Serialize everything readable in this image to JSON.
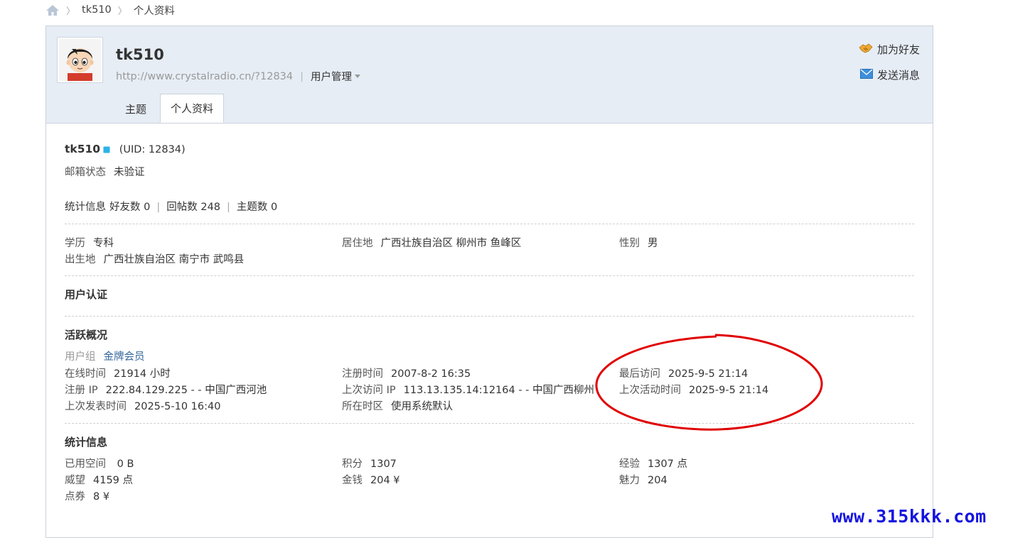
{
  "breadcrumb": {
    "user": "tk510",
    "current": "个人资料"
  },
  "header": {
    "username": "tk510",
    "url": "http://www.crystalradio.cn/?12834",
    "manage_label": "用户管理",
    "actions": {
      "add_friend": "加为好友",
      "send_message": "发送消息"
    },
    "tabs": [
      "主题",
      "个人资料"
    ]
  },
  "profile": {
    "name": "tk510",
    "uid": "(UID: 12834)",
    "email_label": "邮箱状态",
    "email_value": "未验证",
    "stats_label": "统计信息",
    "friends": "好友数 0",
    "replies": "回帖数 248",
    "topics": "主题数 0"
  },
  "basic": {
    "edu_label": "学历",
    "edu_value": "专科",
    "live_label": "居住地",
    "live_value": "广西壮族自治区 柳州市 鱼峰区",
    "gender_label": "性别",
    "gender_value": "男",
    "birth_label": "出生地",
    "birth_value": "广西壮族自治区 南宁市 武鸣县"
  },
  "auth": {
    "title": "用户认证"
  },
  "activity": {
    "title": "活跃概况",
    "group_label": "用户组",
    "group_value": "金牌会员",
    "online_label": "在线时间",
    "online_value": "21914 小时",
    "reg_time_label": "注册时间",
    "reg_time_value": "2007-8-2 16:35",
    "last_visit_label": "最后访问",
    "last_visit_value": "2025-9-5 21:14",
    "reg_ip_label": "注册 IP",
    "reg_ip_value": "222.84.129.225 - - 中国广西河池",
    "last_ip_label": "上次访问 IP",
    "last_ip_value": "113.13.135.14:12164 - - 中国广西柳州",
    "last_active_label": "上次活动时间",
    "last_active_value": "2025-9-5 21:14",
    "last_post_label": "上次发表时间",
    "last_post_value": "2025-5-10 16:40",
    "tz_label": "所在时区",
    "tz_value": "使用系统默认"
  },
  "statistics": {
    "title": "统计信息",
    "space_label": "已用空间",
    "space_value": " 0 B",
    "points_label": "积分",
    "points_value": "1307",
    "exp_label": "经验",
    "exp_value": "1307 点",
    "prestige_label": "威望",
    "prestige_value": "4159 点",
    "money_label": "金钱",
    "money_value": "204 ¥",
    "charm_label": "魅力",
    "charm_value": "204",
    "coupon_label": "点券",
    "coupon_value": "8 ¥"
  },
  "watermark": "www.315kkk.com",
  "colors": {
    "annotation": "#e00000",
    "watermark": "#1414e0",
    "link": "#336699",
    "header_bg": "#e6edf5"
  }
}
